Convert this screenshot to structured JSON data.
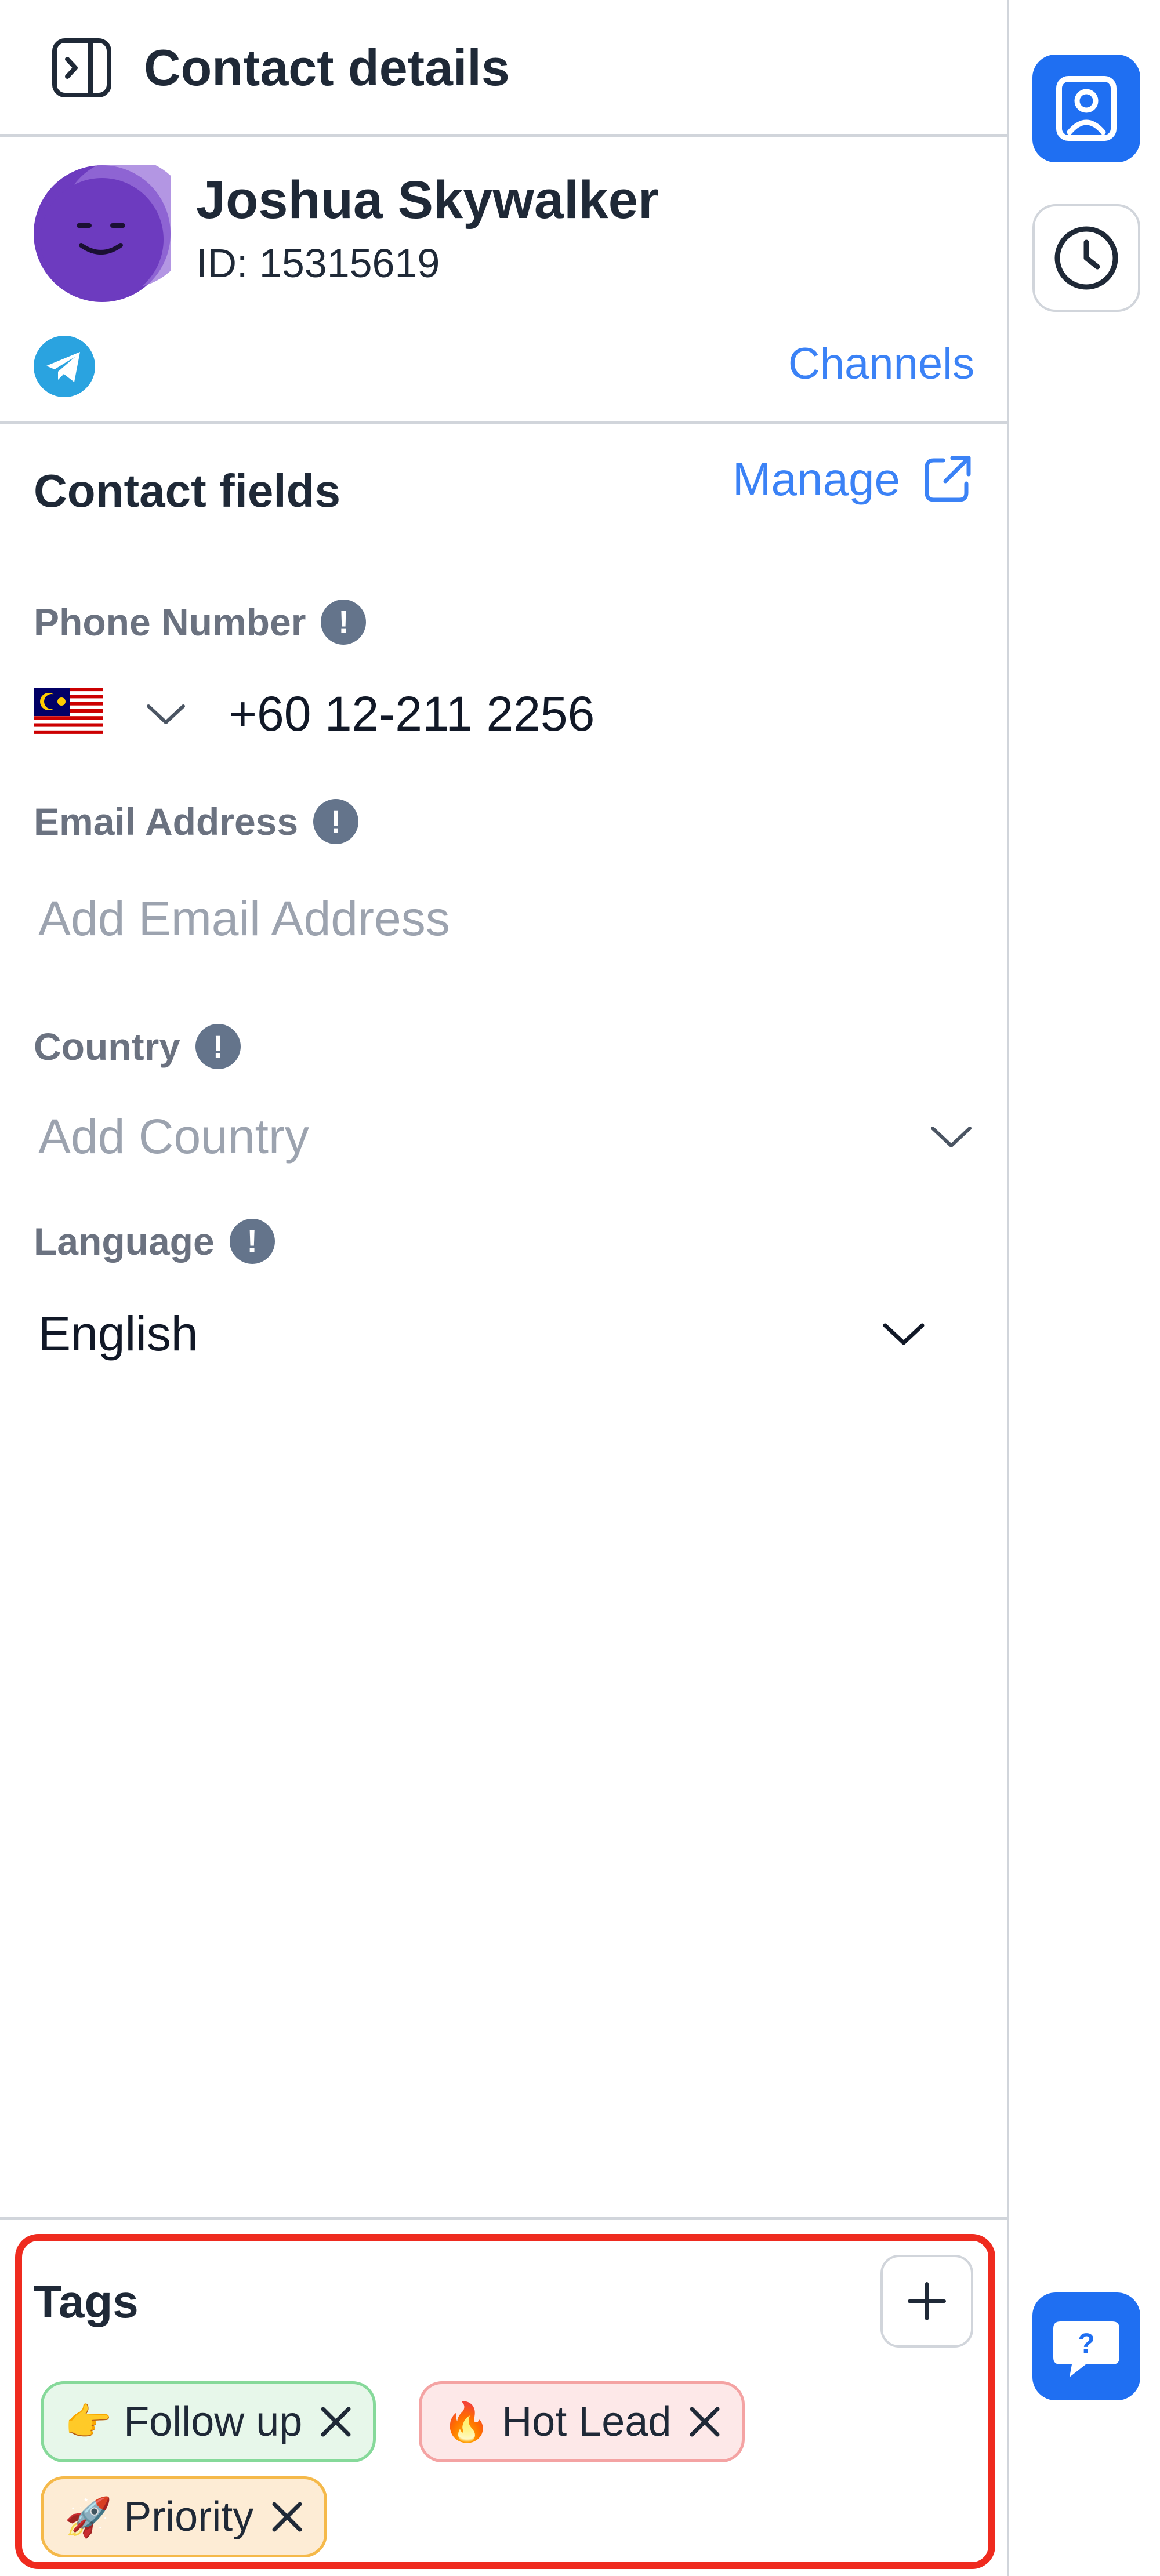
{
  "header": {
    "title": "Contact details"
  },
  "contact": {
    "name": "Joshua Skywalker",
    "id_text": "ID: 15315619",
    "channel_icon": "telegram-icon",
    "channels_link": "Channels"
  },
  "contact_fields": {
    "title": "Contact fields",
    "manage_label": "Manage",
    "phone": {
      "label": "Phone Number",
      "country_flag": "malaysia-flag",
      "value": "+60 12-211 2256"
    },
    "email": {
      "label": "Email Address",
      "placeholder": "Add Email Address"
    },
    "country": {
      "label": "Country",
      "placeholder": "Add Country"
    },
    "language": {
      "label": "Language",
      "value": "English"
    },
    "info_glyph": "!"
  },
  "tags": {
    "title": "Tags",
    "items": [
      {
        "emoji": "👉",
        "label": "Follow up",
        "color": "#e7f7ea",
        "border": "#86d99a"
      },
      {
        "emoji": "🔥",
        "label": "Hot Lead",
        "color": "#fde8e8",
        "border": "#f4a3a3"
      },
      {
        "emoji": "🚀",
        "label": "Priority",
        "color": "#fdecd5",
        "border": "#f5b94a"
      }
    ]
  },
  "rail": {
    "help_glyph": "?"
  },
  "colors": {
    "accent": "#1f6ff2",
    "link": "#3b82f6",
    "highlight": "#ef2b1f",
    "avatar": "#6d3bbf"
  }
}
